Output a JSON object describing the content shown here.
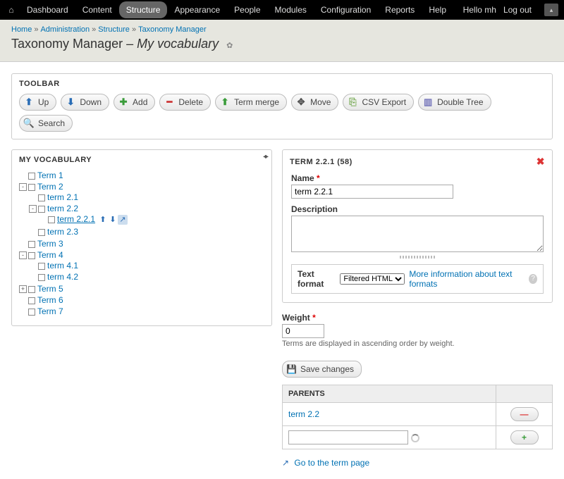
{
  "topbar": {
    "menu": [
      "Dashboard",
      "Content",
      "Structure",
      "Appearance",
      "People",
      "Modules",
      "Configuration",
      "Reports",
      "Help"
    ],
    "active": "Structure",
    "hello": "Hello mh",
    "logout": "Log out"
  },
  "breadcrumb": [
    "Home",
    "Administration",
    "Structure",
    "Taxonomy Manager"
  ],
  "page_title_prefix": "Taxonomy Manager – ",
  "page_title_vocab": "My vocabulary",
  "toolbar": {
    "title": "TOOLBAR",
    "buttons": [
      {
        "icon": "up",
        "label": "Up"
      },
      {
        "icon": "down",
        "label": "Down"
      },
      {
        "icon": "add",
        "label": "Add"
      },
      {
        "icon": "del",
        "label": "Delete"
      },
      {
        "icon": "merge",
        "label": "Term merge"
      },
      {
        "icon": "move",
        "label": "Move"
      },
      {
        "icon": "csv",
        "label": "CSV Export"
      },
      {
        "icon": "dbl",
        "label": "Double Tree"
      },
      {
        "icon": "search",
        "label": "Search"
      }
    ]
  },
  "tree": {
    "title": "MY VOCABULARY",
    "items": [
      {
        "label": "Term 1",
        "tog": ""
      },
      {
        "label": "Term 2",
        "tog": "-",
        "children": [
          {
            "label": "term 2.1",
            "tog": ""
          },
          {
            "label": "term 2.2",
            "tog": "-",
            "children": [
              {
                "label": "term 2.2.1",
                "tog": "",
                "selected": true,
                "icons": true
              }
            ]
          },
          {
            "label": "term 2.3",
            "tog": ""
          }
        ]
      },
      {
        "label": "Term 3",
        "tog": ""
      },
      {
        "label": "Term 4",
        "tog": "-",
        "children": [
          {
            "label": "term 4.1",
            "tog": ""
          },
          {
            "label": "term 4.2",
            "tog": ""
          }
        ]
      },
      {
        "label": "Term 5",
        "tog": "+"
      },
      {
        "label": "Term 6",
        "tog": ""
      },
      {
        "label": "Term 7",
        "tog": ""
      }
    ]
  },
  "term": {
    "header": "TERM 2.2.1 (58)",
    "name_label": "Name",
    "name_value": "term 2.2.1",
    "desc_label": "Description",
    "desc_value": "",
    "format_label": "Text format",
    "format_value": "Filtered HTML",
    "format_info": "More information about text formats",
    "weight_label": "Weight",
    "weight_value": "0",
    "weight_help": "Terms are displayed in ascending order by weight.",
    "save": "Save changes",
    "parents_header": "PARENTS",
    "parent_link": "term 2.2",
    "goto": "Go to the term page"
  }
}
